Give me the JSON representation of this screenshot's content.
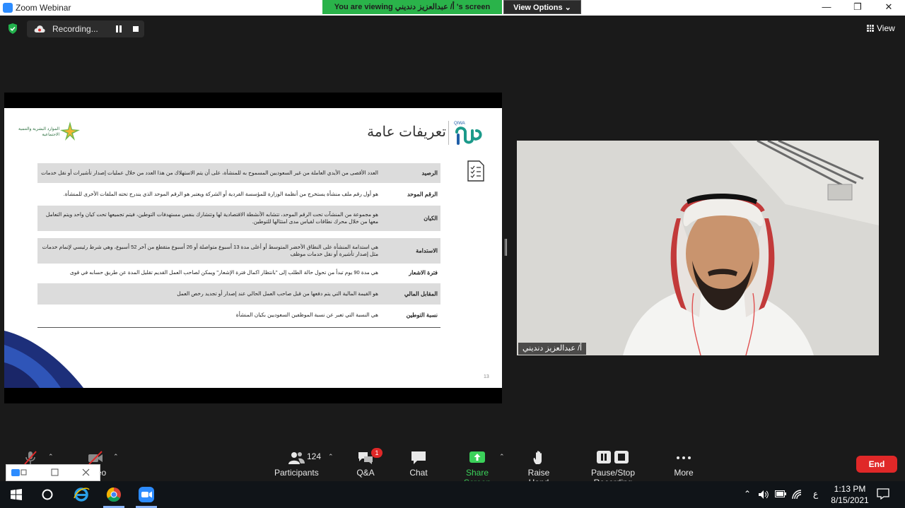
{
  "window": {
    "app_title": "Zoom Webinar",
    "minimize": "—",
    "restore": "❐",
    "close": "✕"
  },
  "banner": {
    "viewing_text": "You are viewing أ/ عبدالعزيز دنديني 's screen",
    "view_options_label": "View Options ⌄"
  },
  "recording": {
    "label": "Recording..."
  },
  "view_toggle": {
    "label": "View"
  },
  "slide": {
    "title": "تعريفات عامة",
    "brand_text": "QIWA",
    "ministry_text": "الموارد البشرية والتنمية الاجتماعية",
    "page_number": "13",
    "rows": [
      {
        "term": "الرصيد",
        "definition": "العدد الأقصى من الأيدي العاملة من غير السعوديين المسموح به للمنشأة، على أن يتم الاستهلاك من هذا العدد من خلال عمليات إصدار تأشيرات أو نقل خدمات",
        "shaded": true
      },
      {
        "term": "الرقم الموحد",
        "definition": "هو أول رقم ملف منشأة يستخرج من أنظمة الوزارة للمؤسسة الفردية أو الشركة ويعتبر هو الرقم الموحد الذي يندرج تحته الملفات الأخرى للمنشأة.",
        "shaded": false
      },
      {
        "term": "الكيان",
        "definition": "هو مجموعة من المنشآت تحت الرقم الموحد، تتشابه الأنشطة الاقتصادية لها وتتشارك بنفس مستهدفات التوطين، فيتم تجميعها تحت كيان واحد ويتم التعامل معها من خلال محرك نطاقات لقياس مدى امتثالها للتوطين.",
        "shaded": true
      },
      {
        "term": "الاستدامة",
        "definition": "هي استدامة المنشأة على النطاق الأخضر المتوسط أو أعلى مدة 13 أسبوع متواصلة أو 26 أسبوع متقطع من آخر 52 أسبوع، وهي شرط رئيسي لإتمام خدمات مثل إصدار تأشيرة أو نقل خدمات موظف",
        "shaded": true
      },
      {
        "term": "فترة الاشعار",
        "definition": "هي مدة 90 يوم تبدأ من تحول حالة الطلب إلى \"بانتظار اكمال فترة الإشعار\" ويمكن لصاحب العمل القديم تقليل المدة عن طريق حسابه في قوى",
        "shaded": false
      },
      {
        "term": "المقابل المالي",
        "definition": "هو القيمة المالية التي يتم دفعها من قبل صاحب العمل الحالي عند إصدار أو تجديد رخص العمل",
        "shaded": true
      },
      {
        "term": "نسبة التوطين",
        "definition": "هي النسبة التي تعبر عن نسبة الموظفين السعوديين بكيان المنشأة",
        "shaded": false
      }
    ]
  },
  "video": {
    "participant_name": "أ/ عبدالعزيز دنديني"
  },
  "toolbar": {
    "video_label": "Video",
    "participants_label": "Participants",
    "participants_count": "124",
    "qa_label": "Q&A",
    "qa_badge": "1",
    "chat_label": "Chat",
    "share_label": "Share Screen",
    "raise_hand_label": "Raise Hand",
    "pause_stop_label": "Pause/Stop Recording",
    "more_label": "More",
    "end_label": "End"
  },
  "taskbar": {
    "time": "1:13 PM",
    "date": "8/15/2021",
    "lang": "ع"
  },
  "colors": {
    "share_green": "#3bd15a",
    "banner_green": "#2ab34a",
    "end_red": "#e02828",
    "zoom_blue": "#2d8cff"
  }
}
